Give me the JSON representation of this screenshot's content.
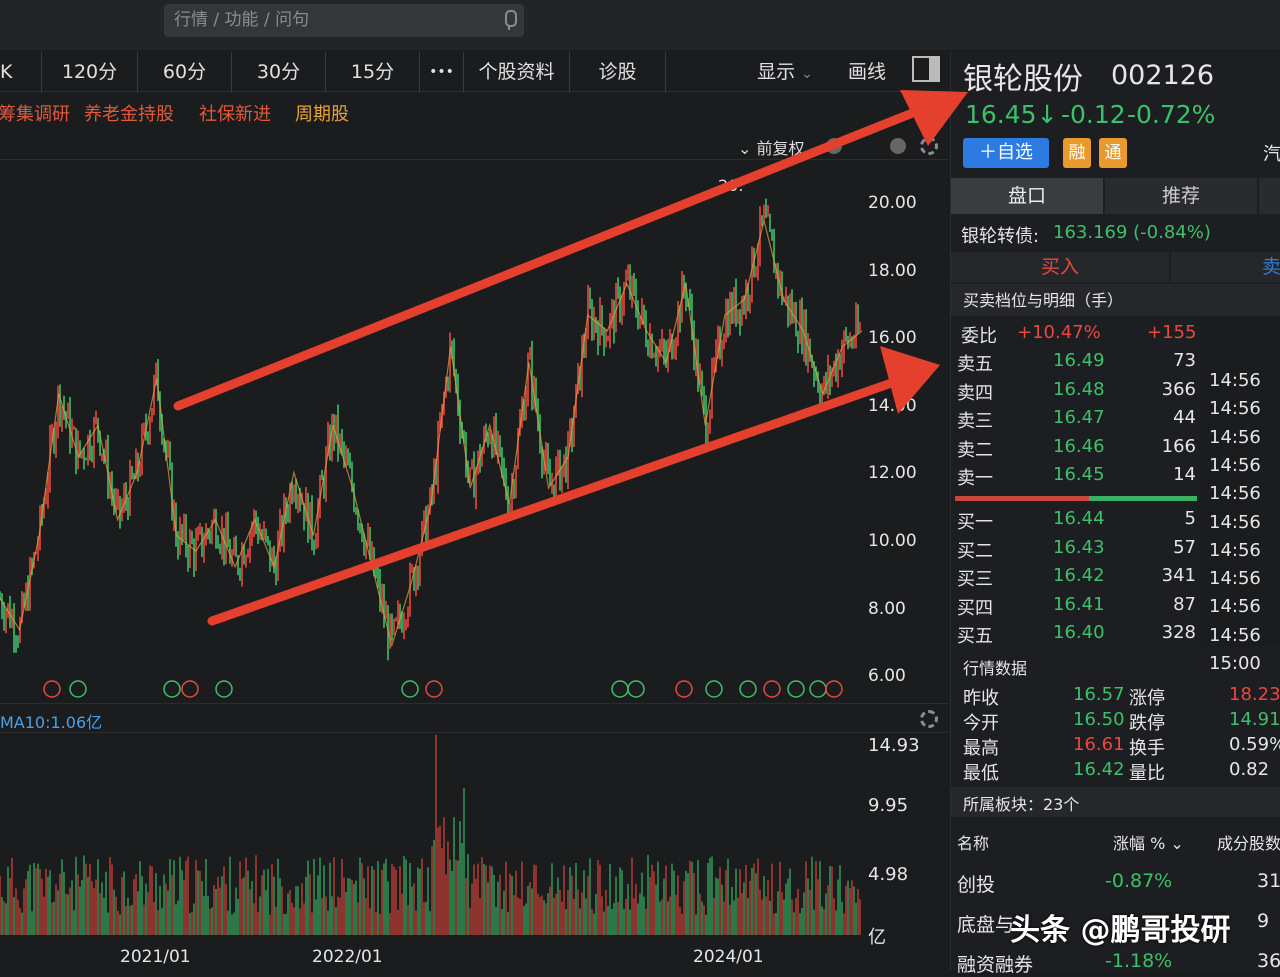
{
  "search": {
    "placeholder": "行情 / 功能 / 问句"
  },
  "toolbar": {
    "items": [
      "K",
      "120分",
      "60分",
      "30分",
      "15分",
      "•••",
      "个股资料",
      "诊股"
    ],
    "display": "显示",
    "draw": "画线"
  },
  "tags": [
    "筹集调研",
    "养老金持股",
    "社保新进",
    "周期股"
  ],
  "chart_opts": {
    "adjust": "前复权"
  },
  "stock": {
    "name": "银轮股份",
    "code": "002126",
    "price": "16.45↓",
    "change": "-0.12",
    "pct": "-0.72%",
    "add_btn": "＋自选",
    "rong": "融",
    "tong": "通",
    "extra": "汽"
  },
  "tabs": {
    "pankou": "盘口",
    "tuijian": "推荐"
  },
  "bond": {
    "label": "银轮转债:",
    "value": "163.169 (-0.84%)"
  },
  "trade": {
    "buy": "买入",
    "sell": "卖"
  },
  "orderbook": {
    "title": "买卖档位与明细（手）",
    "weibi": "委比",
    "weibi_pct": "+10.47%",
    "weibi_val": "+155",
    "detail": "明细",
    "sells": [
      {
        "l": "卖五",
        "p": "16.49",
        "v": "73"
      },
      {
        "l": "卖四",
        "p": "16.48",
        "v": "366"
      },
      {
        "l": "卖三",
        "p": "16.47",
        "v": "44"
      },
      {
        "l": "卖二",
        "p": "16.46",
        "v": "166"
      },
      {
        "l": "卖一",
        "p": "16.45",
        "v": "14"
      }
    ],
    "buys": [
      {
        "l": "买一",
        "p": "16.44",
        "v": "5"
      },
      {
        "l": "买二",
        "p": "16.43",
        "v": "57"
      },
      {
        "l": "买三",
        "p": "16.42",
        "v": "341"
      },
      {
        "l": "买四",
        "p": "16.41",
        "v": "87"
      },
      {
        "l": "买五",
        "p": "16.40",
        "v": "328"
      }
    ],
    "times": [
      "14:56",
      "14:56",
      "14:56",
      "14:56",
      "14:56",
      "14:56",
      "14:56",
      "14:56",
      "14:56",
      "14:56",
      "15:00"
    ]
  },
  "quote": {
    "title": "行情数据",
    "rows": [
      {
        "a": "昨收",
        "av": "16.57",
        "b": "涨停",
        "bv": "18.23"
      },
      {
        "a": "今开",
        "av": "16.50",
        "b": "跌停",
        "bv": "14.91"
      },
      {
        "a": "最高",
        "av": "16.61",
        "b": "换手",
        "bv": "0.59%"
      },
      {
        "a": "最低",
        "av": "16.42",
        "b": "量比",
        "bv": "0.82"
      }
    ]
  },
  "sectors": {
    "title": "所属板块：23个",
    "h_name": "名称",
    "h_pct": "涨幅 %",
    "h_cnt": "成分股数",
    "rows": [
      {
        "n": "创投",
        "p": "-0.87%",
        "c": "31"
      },
      {
        "n": "底盘与",
        "p": "",
        "c": "9"
      },
      {
        "n": "融资融券",
        "p": "-1.18%",
        "c": "36"
      }
    ]
  },
  "price_axis": [
    "20.00",
    "18.00",
    "16.00",
    "14.00",
    "12.00",
    "10.00",
    "8.00",
    "6.00"
  ],
  "vol_axis": [
    "14.93",
    "9.95",
    "4.98",
    "亿"
  ],
  "vol_label": "MA10:1.06亿",
  "x_axis": [
    "2021/01",
    "2022/01",
    "2024/01"
  ],
  "peak_label": "20.",
  "watermark": "头条 @鹏哥投研",
  "chart_data": {
    "type": "line",
    "series": [
      {
        "name": "",
        "values": [
          8.5,
          7.5,
          10.5,
          15,
          13,
          14,
          11,
          12.5,
          15.5,
          10.5,
          10,
          11,
          9.5,
          11,
          9.5,
          12.5,
          10.5,
          14,
          12,
          9.5,
          7,
          9,
          11.5,
          16.5,
          12,
          14,
          11.5,
          16,
          12,
          13,
          17.5,
          17,
          18.5,
          17,
          16,
          18.5,
          14,
          17.5,
          18,
          20.5,
          18,
          17,
          15,
          16.5,
          17
        ]
      }
    ],
    "ylim": [
      6,
      21
    ]
  }
}
